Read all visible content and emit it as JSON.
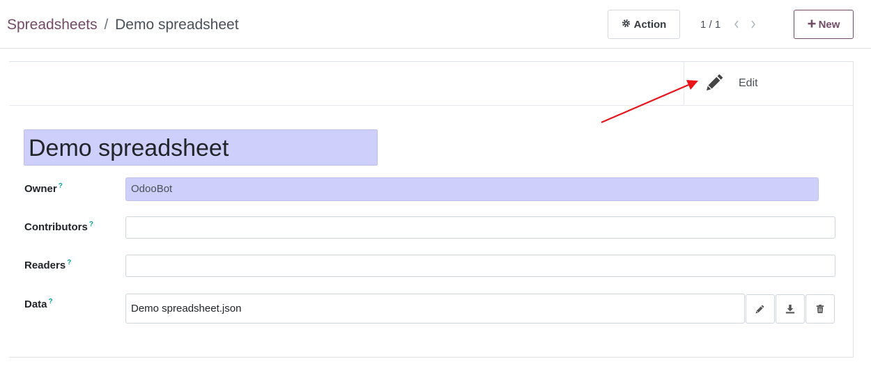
{
  "breadcrumb": {
    "parent": "Spreadsheets",
    "separator": "/",
    "current": "Demo spreadsheet"
  },
  "toolbar": {
    "action_label": "Action",
    "action_icon": "gear-icon",
    "pager_value": "1 / 1",
    "new_label": "New",
    "new_icon": "plus-icon"
  },
  "button_box": {
    "edit_label": "Edit",
    "edit_icon": "pencil-icon"
  },
  "form": {
    "title": "Demo spreadsheet",
    "help_mark": "?",
    "fields": {
      "owner": {
        "label": "Owner",
        "value": "OdooBot"
      },
      "contributors": {
        "label": "Contributors",
        "value": ""
      },
      "readers": {
        "label": "Readers",
        "value": ""
      },
      "data": {
        "label": "Data",
        "value": "Demo spreadsheet.json"
      }
    },
    "file_actions": [
      "pencil-icon",
      "download-icon",
      "trash-icon"
    ]
  },
  "colors": {
    "brand": "#714b67",
    "help": "#00a09d",
    "required_field": "#cfcffb",
    "annotation_arrow": "#e8141a"
  }
}
